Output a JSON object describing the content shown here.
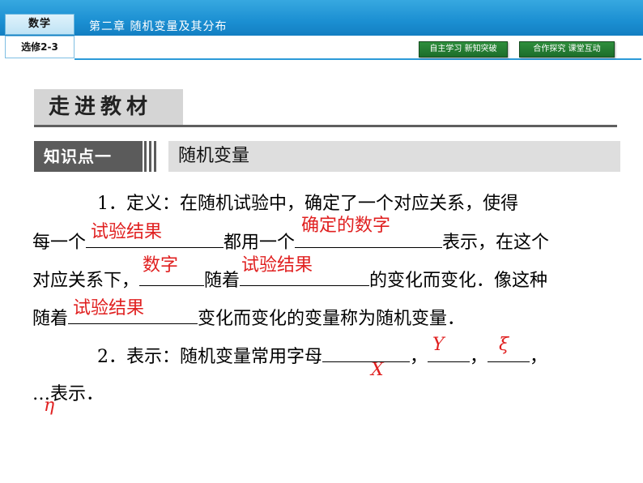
{
  "header": {
    "subject": "数学",
    "course": "选修2-3",
    "chapter_title": "第二章    随机变量及其分布",
    "nav_buttons": [
      "自主学习  新知突破",
      "合作探究  课堂互动"
    ]
  },
  "section": {
    "label": "走进教材"
  },
  "knowledge_point": {
    "label": "知识点一",
    "title": "随机变量"
  },
  "body": {
    "p1_line1": "1．定义：在随机试验中，确定了一个对应关系，使得",
    "p1_line2_a": "每一个",
    "answer1": "试验结果",
    "p1_line2_b": "都用一个",
    "answer2": "确定的数字",
    "p1_line2_c": "表示，在这个",
    "p1_line3_a": "对应关系下，",
    "answer3": "数字",
    "p1_line3_b": "随着",
    "answer4": "试验结果",
    "p1_line3_c": "的变化而变化．像这种",
    "p1_line4_a": "随着",
    "answer5": "试验结果",
    "p1_line4_b": "变化而变化的变量称为随机变量．",
    "p2_line1_a": "2．表示：随机变量常用字母",
    "answer6": "X",
    "answer7": "Y",
    "answer8": "ξ",
    "comma": "，",
    "p2_line2_a": "…",
    "answer9": "η",
    "p2_line2_b": "表示．"
  }
}
